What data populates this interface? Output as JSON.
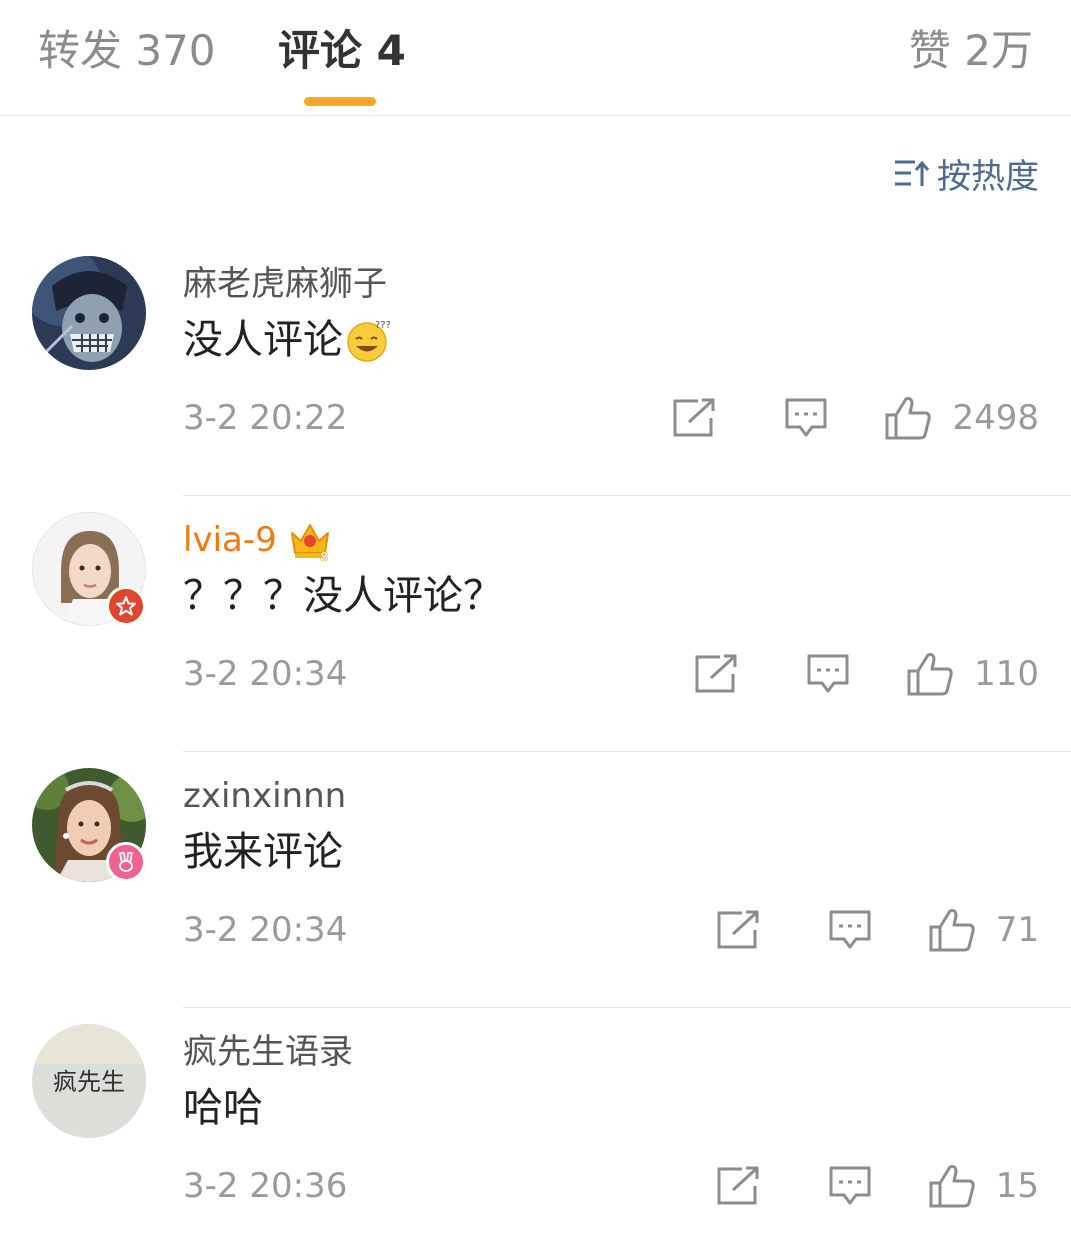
{
  "tabs": {
    "repost_label": "转发 370",
    "comment_label": "评论 4",
    "like_label": "赞 2万",
    "accent_color": "#f9a825"
  },
  "sort": {
    "label": "按热度",
    "icon": "sort-icon"
  },
  "comments": [
    {
      "name": "麻老虎麻狮子",
      "text": "没人评论",
      "emoji": "dizzy-smile-emoji",
      "time": "3-2 20:22",
      "likes": "2498"
    },
    {
      "name": "lvia-9",
      "text": "？？？没人评论？",
      "crown": "crown-vip-icon",
      "badge": "star-badge",
      "time": "3-2 20:34",
      "likes": "110"
    },
    {
      "name": "zxinxinnn",
      "text": "我来评论",
      "badge": "bunny-badge",
      "time": "3-2 20:34",
      "likes": "71"
    },
    {
      "name": "疯先生语录",
      "text": "哈哈",
      "time": "3-2 20:36",
      "likes": "15",
      "avatar_text": "疯先生"
    }
  ]
}
